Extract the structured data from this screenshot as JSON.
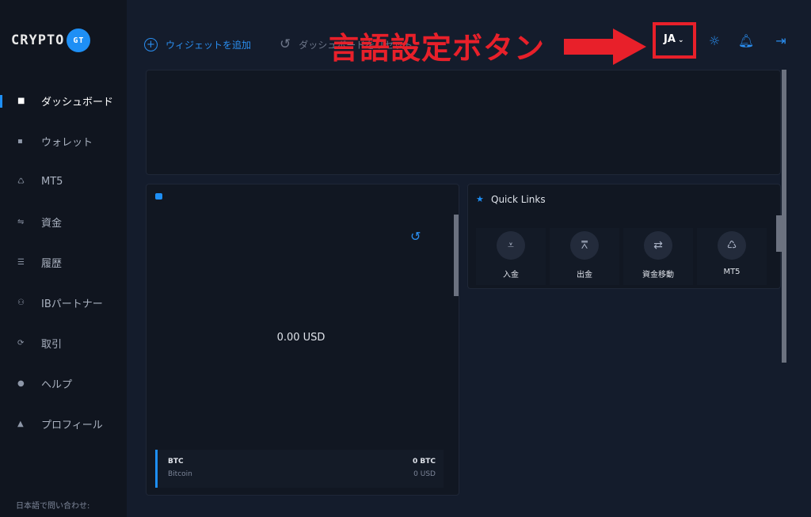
{
  "brand": {
    "logo_text": "CRYPTO",
    "logo_badge": "GT"
  },
  "sidebar": {
    "items": [
      {
        "label": "ダッシュボード",
        "icon": "grid-icon",
        "active": true
      },
      {
        "label": "ウォレット",
        "icon": "wallet-icon"
      },
      {
        "label": "MT5",
        "icon": "mt5-icon"
      },
      {
        "label": "資金",
        "icon": "transfer-icon"
      },
      {
        "label": "履歴",
        "icon": "list-icon"
      },
      {
        "label": "IBパートナー",
        "icon": "partner-icon"
      },
      {
        "label": "取引",
        "icon": "sync-icon"
      },
      {
        "label": "ヘルプ",
        "icon": "help-icon"
      },
      {
        "label": "プロフィール",
        "icon": "user-icon"
      }
    ],
    "contact": "日本語で問い合わせ:"
  },
  "toolbar": {
    "add_widget": "ウィジェットを追加",
    "reset_dashboard": "ダッシュボードをリセット",
    "language": "JA"
  },
  "wallet": {
    "total": "0.00 USD",
    "asset": {
      "symbol": "BTC",
      "name": "Bitcoin",
      "amount": "0 BTC",
      "usd": "0 USD"
    }
  },
  "quick_links": {
    "title": "Quick Links",
    "items": [
      {
        "label": "入金",
        "icon": "deposit-icon"
      },
      {
        "label": "出金",
        "icon": "withdraw-icon"
      },
      {
        "label": "資金移動",
        "icon": "transfer-icon"
      },
      {
        "label": "MT5",
        "icon": "mt5-icon"
      }
    ]
  },
  "annotation": {
    "text": "言語設定ボタン",
    "color": "#e8202a"
  },
  "colors": {
    "accent": "#1e8ff5",
    "background": "#141c2c",
    "sidebar": "#10151f"
  }
}
